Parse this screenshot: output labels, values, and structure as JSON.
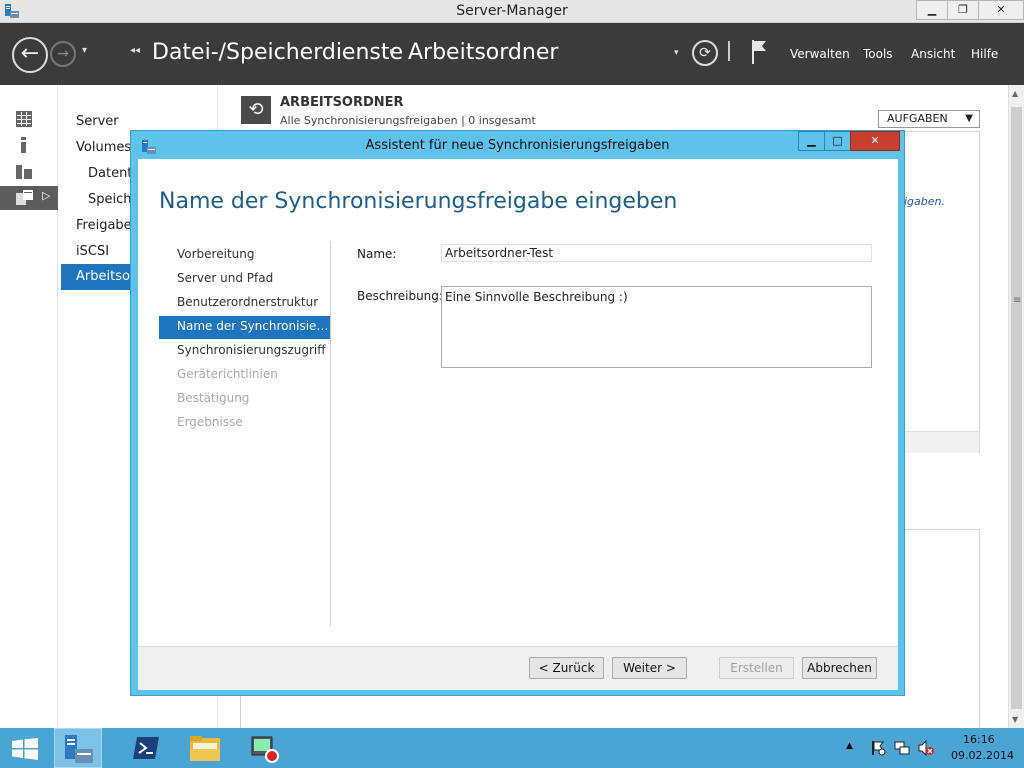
{
  "window": {
    "title": "Server-Manager",
    "minimize_glyph": "▁",
    "restore_glyph": "❐",
    "close_glyph": "✕"
  },
  "header": {
    "back_glyph": "←",
    "forward_glyph": "→",
    "dropdown_glyph": "▾",
    "breadcrumb_arrows_glyph": "◂◂",
    "breadcrumb_root": "Datei-/Speicherdienste",
    "breadcrumb_sep_glyph": "▸",
    "breadcrumb_current": "Arbeitsordner",
    "refresh_glyph": "⟳",
    "menu": {
      "manage": "Verwalten",
      "tools": "Tools",
      "view": "Ansicht",
      "help": "Hilfe"
    }
  },
  "nav": {
    "items": [
      "Server",
      "Volumes",
      "Datent",
      "Speich",
      "Freigabe",
      "iSCSI",
      "Arbeitsor"
    ]
  },
  "main": {
    "tile_glyph": "⟲",
    "tile_title": "ARBEITSORDNER",
    "tile_subtitle": "Alle Synchronisierungsfreigaben | 0 insgesamt",
    "tasks_label": "AUFGABEN",
    "tasks_caret": "▼",
    "hint_fragment": "igaben."
  },
  "scrollbar": {
    "up_glyph": "▲",
    "down_glyph": "▼",
    "grip_glyph": "≡"
  },
  "dialog": {
    "title": "Assistent für neue Synchronisierungsfreigaben",
    "minimize_glyph": "▁",
    "maximize_glyph": "□",
    "close_glyph": "✕",
    "heading": "Name der Synchronisierungsfreigabe eingeben",
    "steps": [
      {
        "label": "Vorbereitung",
        "state": "done"
      },
      {
        "label": "Server und Pfad",
        "state": "done"
      },
      {
        "label": "Benutzerordnerstruktur",
        "state": "done"
      },
      {
        "label": "Name der Synchronisieru...",
        "state": "active"
      },
      {
        "label": "Synchronisierungszugriff",
        "state": "enabled"
      },
      {
        "label": "Geräterichtlinien",
        "state": "disabled"
      },
      {
        "label": "Bestätigung",
        "state": "disabled"
      },
      {
        "label": "Ergebnisse",
        "state": "disabled"
      }
    ],
    "name_label": "Name:",
    "name_value": "Arbeitsordner-Test",
    "description_label": "Beschreibung:",
    "description_value": "Eine Sinnvolle Beschreibung :)",
    "buttons": {
      "back": "< Zurück",
      "next": "Weiter >",
      "create": "Erstellen",
      "cancel": "Abbrechen"
    }
  },
  "taskbar": {
    "tray_arrow_glyph": "▲",
    "time": "16:16",
    "date": "09.02.2014"
  },
  "colors": {
    "accent_blue": "#1f75bd",
    "dialog_frame": "#5ec2ea",
    "taskbar": "#4aa5d4",
    "header_bg": "#3b3b3b",
    "close_red": "#c7402f"
  }
}
